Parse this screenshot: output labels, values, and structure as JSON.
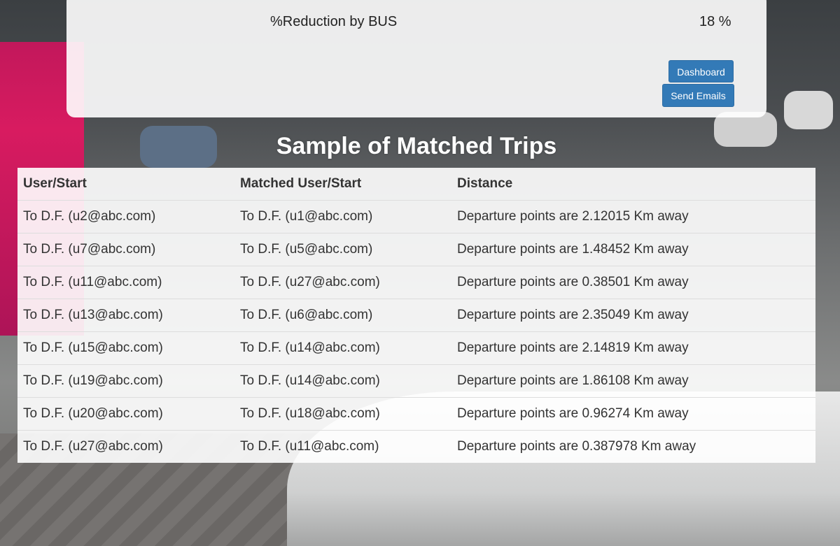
{
  "summary": {
    "metric_label": "%Reduction by BUS",
    "metric_value": "18 %"
  },
  "actions": {
    "dashboard_label": "Dashboard",
    "send_emails_label": "Send Emails"
  },
  "section_title": "Sample of Matched Trips",
  "table": {
    "headers": [
      "User/Start",
      "Matched User/Start",
      "Distance"
    ],
    "rows": [
      [
        "To D.F. (u2@abc.com)",
        "To D.F. (u1@abc.com)",
        "Departure points are 2.12015 Km away"
      ],
      [
        "To D.F. (u7@abc.com)",
        "To D.F. (u5@abc.com)",
        "Departure points are 1.48452 Km away"
      ],
      [
        "To D.F. (u11@abc.com)",
        "To D.F. (u27@abc.com)",
        "Departure points are 0.38501 Km away"
      ],
      [
        "To D.F. (u13@abc.com)",
        "To D.F. (u6@abc.com)",
        "Departure points are 2.35049 Km away"
      ],
      [
        "To D.F. (u15@abc.com)",
        "To D.F. (u14@abc.com)",
        "Departure points are 2.14819 Km away"
      ],
      [
        "To D.F. (u19@abc.com)",
        "To D.F. (u14@abc.com)",
        "Departure points are 1.86108 Km away"
      ],
      [
        "To D.F. (u20@abc.com)",
        "To D.F. (u18@abc.com)",
        "Departure points are 0.96274 Km away"
      ],
      [
        "To D.F. (u27@abc.com)",
        "To D.F. (u11@abc.com)",
        "Departure points are 0.387978 Km away"
      ]
    ]
  },
  "colors": {
    "button_bg": "#337ab7",
    "title_text": "#ffffff"
  }
}
